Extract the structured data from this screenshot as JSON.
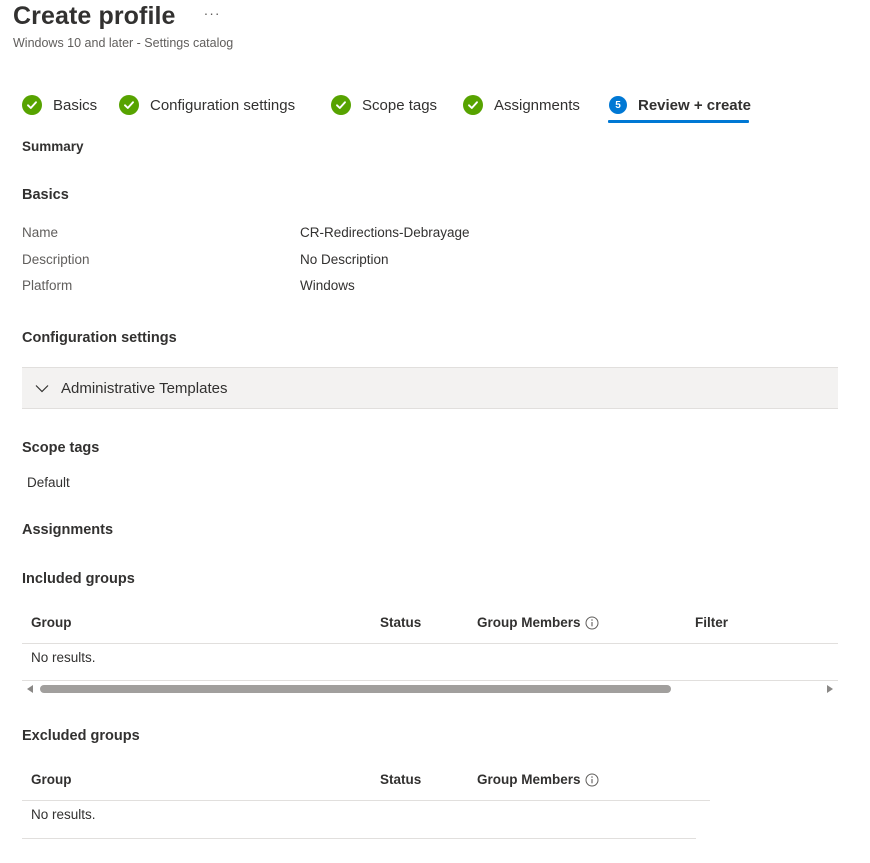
{
  "header": {
    "title": "Create profile",
    "more": "···",
    "subtitle": "Windows 10 and later - Settings catalog"
  },
  "steps": [
    {
      "label": "Basics",
      "state": "complete"
    },
    {
      "label": "Configuration settings",
      "state": "complete"
    },
    {
      "label": "Scope tags",
      "state": "complete"
    },
    {
      "label": "Assignments",
      "state": "complete"
    },
    {
      "label": "Review + create",
      "state": "active",
      "number": "5"
    }
  ],
  "summary": {
    "heading": "Summary",
    "basics": {
      "heading": "Basics",
      "rows": [
        {
          "key": "Name",
          "value": "CR-Redirections-Debrayage"
        },
        {
          "key": "Description",
          "value": "No Description"
        },
        {
          "key": "Platform",
          "value": "Windows"
        }
      ]
    },
    "configuration": {
      "heading": "Configuration settings",
      "accordion_label": "Administrative Templates"
    },
    "scope_tags": {
      "heading": "Scope tags",
      "value": "Default"
    },
    "assignments": {
      "heading": "Assignments",
      "included": {
        "heading": "Included groups",
        "columns": [
          "Group",
          "Status",
          "Group Members",
          "Filter"
        ],
        "empty_text": "No results."
      },
      "excluded": {
        "heading": "Excluded groups",
        "columns": [
          "Group",
          "Status",
          "Group Members"
        ],
        "empty_text": "No results."
      }
    }
  },
  "colors": {
    "complete": "#57a300",
    "accent": "#0078d4",
    "text": "#323130",
    "muted": "#605e5c"
  }
}
